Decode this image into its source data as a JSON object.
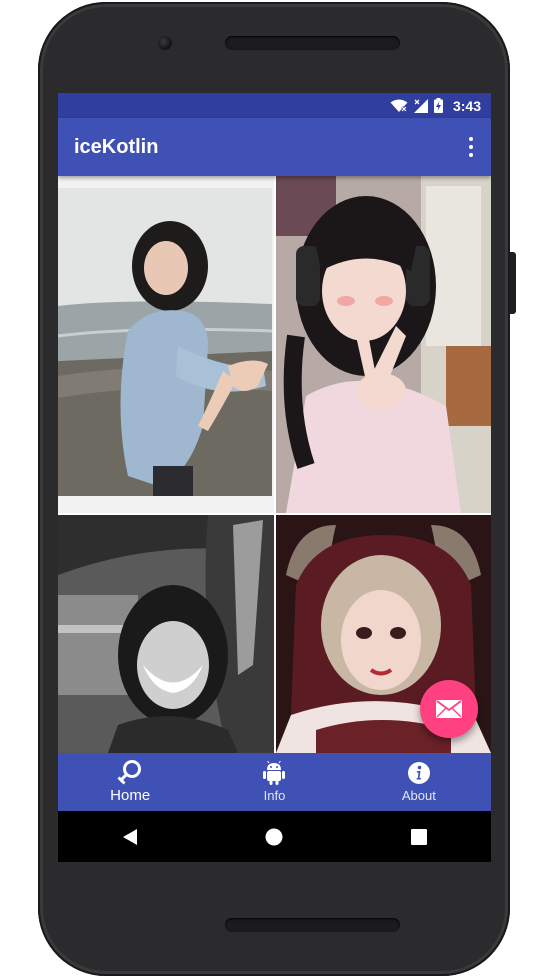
{
  "status_bar": {
    "time": "3:43",
    "icons": [
      "wifi-off-icon",
      "signal-off-icon",
      "battery-charging-icon"
    ]
  },
  "app_bar": {
    "title": "iceKotlin",
    "menu_icon": "more-vert-icon"
  },
  "gallery": {
    "photos": [
      {
        "description_icon": "photo"
      },
      {
        "description_icon": "photo"
      },
      {
        "description_icon": "photo"
      },
      {
        "description_icon": "photo"
      }
    ]
  },
  "fab": {
    "icon": "mail-icon",
    "color": "#ff4081"
  },
  "bottom_nav": {
    "items": [
      {
        "label": "Home",
        "icon": "female-search-icon",
        "active": true
      },
      {
        "label": "Info",
        "icon": "android-icon",
        "active": false
      },
      {
        "label": "About",
        "icon": "info-icon",
        "active": false
      }
    ]
  },
  "system_nav": {
    "icons": [
      "back-icon",
      "home-icon",
      "recents-icon"
    ]
  },
  "colors": {
    "primary": "#3f51b5",
    "primary_dark": "#303f9f",
    "accent": "#ff4081"
  }
}
